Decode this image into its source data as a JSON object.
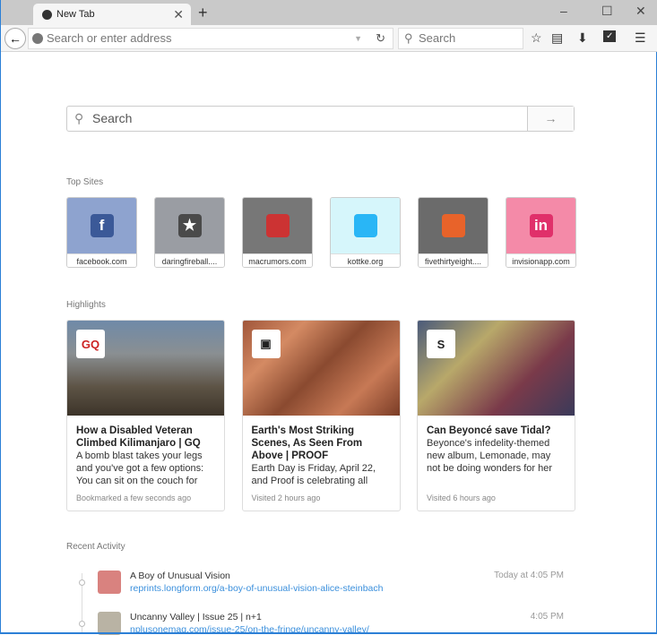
{
  "tab": {
    "title": "New Tab"
  },
  "window": {
    "minimize": "–",
    "maximize": "☐",
    "close": "✕",
    "new_tab": "+"
  },
  "navbar": {
    "url_placeholder": "Search or enter address",
    "search_placeholder": "Search"
  },
  "page": {
    "search_placeholder": "Search",
    "top_sites_label": "Top Sites",
    "highlights_label": "Highlights",
    "recent_label": "Recent Activity"
  },
  "top_sites": [
    {
      "name": "facebook.com",
      "glyph": "f",
      "bg": "#8ea3cf",
      "icon": "#3b5998"
    },
    {
      "name": "daringfireball....",
      "glyph": "★",
      "bg": "#9a9da3",
      "icon": "#4a4a4a"
    },
    {
      "name": "macrumors.com",
      "glyph": "",
      "bg": "#777",
      "icon": "#c33"
    },
    {
      "name": "kottke.org",
      "glyph": "",
      "bg": "#d6f6fb",
      "icon": "#29b6f6"
    },
    {
      "name": "fivethirtyeight....",
      "glyph": "",
      "bg": "#6b6b6b",
      "icon": "#e8632a"
    },
    {
      "name": "invisionapp.com",
      "glyph": "in",
      "bg": "#f48aa8",
      "icon": "#e0306a"
    }
  ],
  "highlights": [
    {
      "badge": "GQ",
      "title": "How a Disabled Veteran Climbed Kilimanjaro | GQ",
      "desc": "A bomb blast takes your legs and you've got a few options: You can sit on the couch for",
      "meta": "Bookmarked a few seconds ago",
      "bg": "linear-gradient(#6f8aa8 0%,#8a8f92 35%,#5d5345 70%,#3c3429 100%)"
    },
    {
      "badge": "▣",
      "title": "Earth's Most Striking Scenes, As Seen From Above | PROOF",
      "desc": "Earth Day is Friday, April 22, and Proof is celebrating all",
      "meta": "Visited 2 hours ago",
      "bg": "linear-gradient(135deg,#a0563a,#d48a63,#8a4a30,#c77955,#7a3c26)"
    },
    {
      "badge": "S",
      "title": "Can Beyoncé save Tidal?",
      "desc": "Beyonce's infedelity-themed new album, Lemonade, may not be doing wonders for her husband's image, but it sure",
      "meta": "Visited 6 hours ago",
      "bg": "linear-gradient(135deg,#4a5a7a,#b8a86a,#7a3a4a,#3a3a5a)"
    }
  ],
  "recent": [
    {
      "title": "A Boy of Unusual Vision",
      "url": "reprints.longform.org/a-boy-of-unusual-vision-alice-steinbach",
      "time": "Today at 4:05 PM"
    },
    {
      "title": "Uncanny Valley | Issue 25 | n+1",
      "url": "nplusonemag.com/issue-25/on-the-fringe/uncanny-valley/",
      "time": "4:05 PM"
    }
  ]
}
